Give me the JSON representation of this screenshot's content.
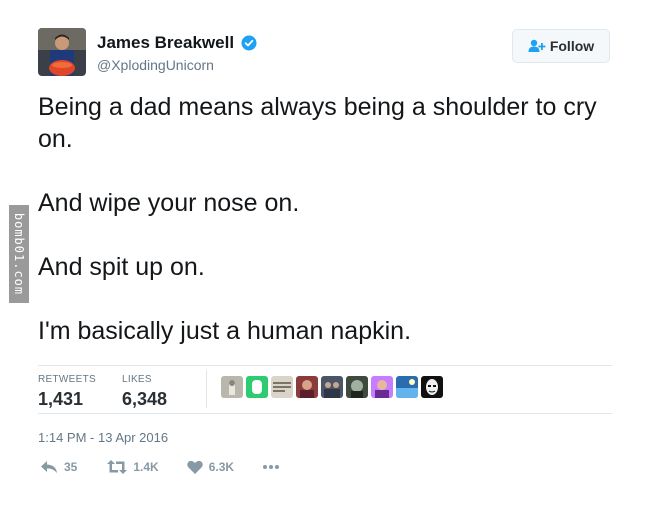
{
  "author": {
    "display_name": "James Breakwell",
    "handle": "@XplodingUnicorn",
    "verified": true
  },
  "follow_button": {
    "label": "Follow"
  },
  "tweet": {
    "paragraphs": [
      "Being a dad means always being a shoulder to cry on.",
      "And wipe your nose on.",
      "And spit up on.",
      "I'm basically just a human napkin."
    ]
  },
  "stats": {
    "retweets_label": "RETWEETS",
    "retweets_value": "1,431",
    "likes_label": "LIKES",
    "likes_value": "6,348"
  },
  "timestamp": "1:14 PM - 13 Apr 2016",
  "actions": {
    "reply_count": "35",
    "retweet_count": "1.4K",
    "like_count": "6.3K"
  },
  "watermark": "bomb01.com",
  "colors": {
    "text": "#14171a",
    "secondary": "#657786",
    "verified": "#1da1f2",
    "follow_icon": "#1da1f2",
    "action_icon": "#8899a6"
  }
}
